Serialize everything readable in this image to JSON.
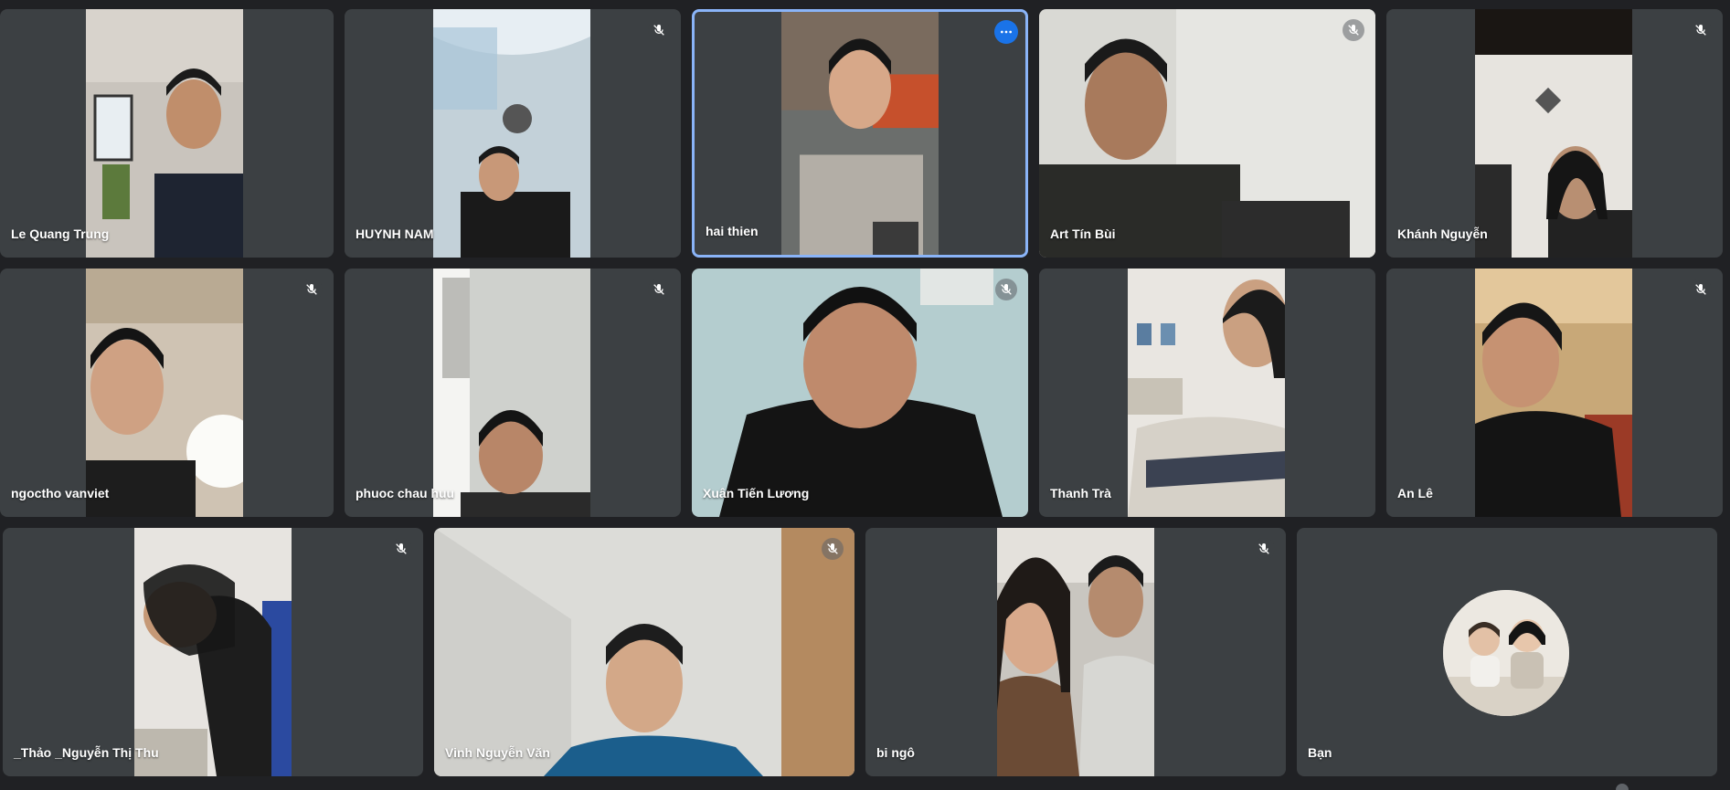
{
  "meeting": {
    "participants": [
      {
        "name": "Le Quang Trung",
        "muted": false,
        "active": false,
        "more_label": ""
      },
      {
        "name": "HUYNH NAM",
        "muted": true,
        "active": false
      },
      {
        "name": "hai thien",
        "muted": false,
        "active": true
      },
      {
        "name": "Art Tín Bùi",
        "muted": true,
        "active": false
      },
      {
        "name": "Khánh Nguyễn",
        "muted": true,
        "active": false
      },
      {
        "name": "ngoctho vanviet",
        "muted": true,
        "active": false
      },
      {
        "name": "phuoc chau huu",
        "muted": true,
        "active": false
      },
      {
        "name": "Xuân Tiến Lương",
        "muted": true,
        "active": false
      },
      {
        "name": "Thanh Trà",
        "muted": false,
        "active": false
      },
      {
        "name": "An Lê",
        "muted": true,
        "active": false
      },
      {
        "name": "_Thảo _Nguyễn Thị Thu",
        "muted": true,
        "active": false
      },
      {
        "name": "Vinh Nguyễn Văn",
        "muted": true,
        "active": false
      },
      {
        "name": "bi ngô",
        "muted": true,
        "active": false
      },
      {
        "name": "Bạn",
        "muted": false,
        "active": false
      }
    ]
  },
  "icons": {
    "mute": "mic-off-icon",
    "more": "more-options-icon"
  },
  "colors": {
    "background": "#202124",
    "tile": "#3c4043",
    "active_border": "#8ab4f8",
    "accent": "#1a73e8"
  }
}
